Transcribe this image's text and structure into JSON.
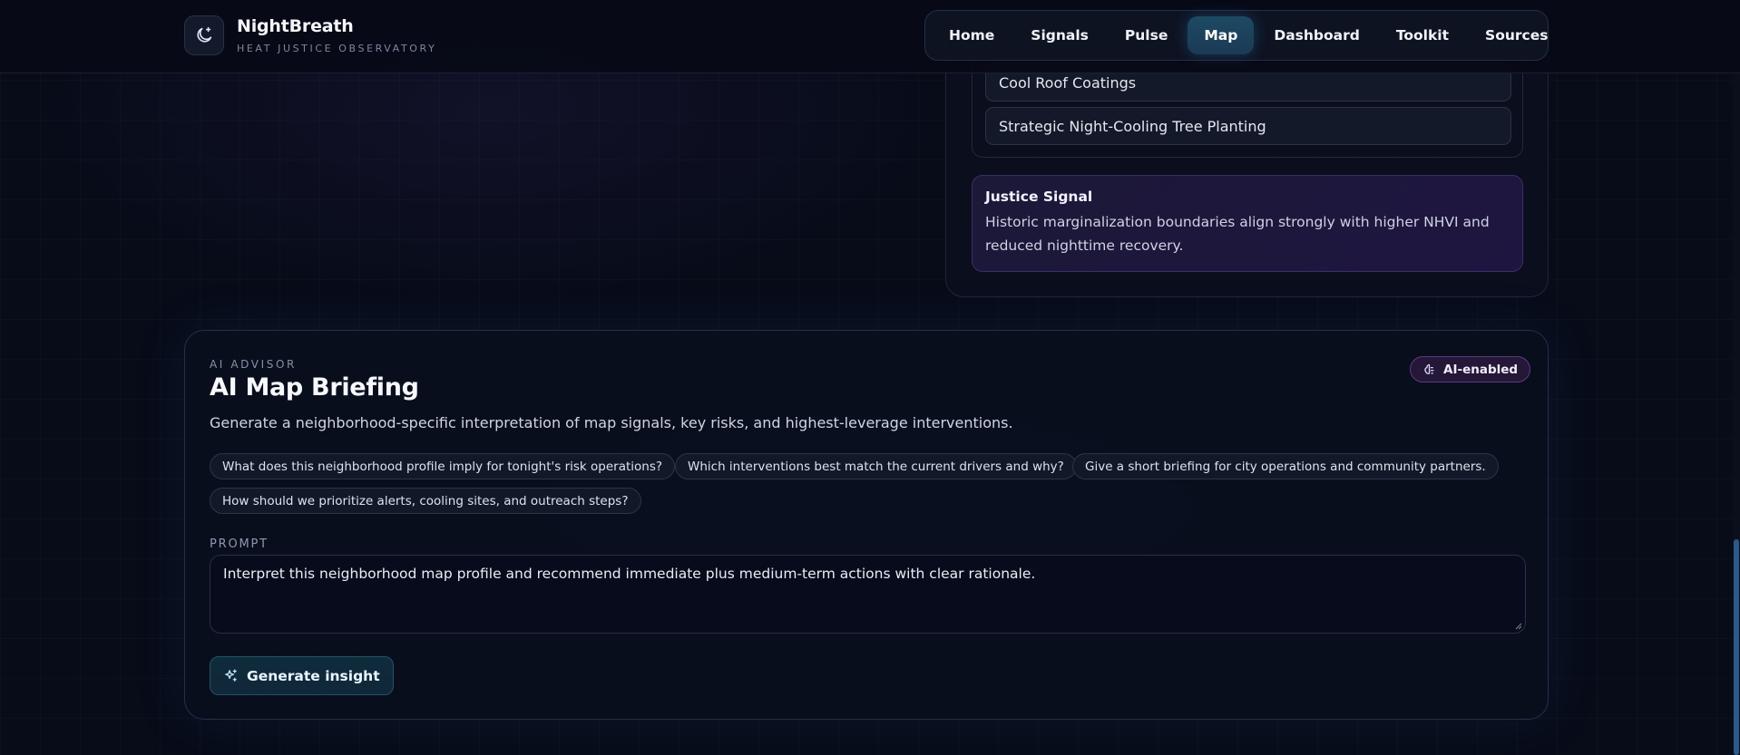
{
  "brand": {
    "name": "NightBreath",
    "tagline": "HEAT JUSTICE OBSERVATORY"
  },
  "nav": {
    "items": [
      {
        "label": "Home"
      },
      {
        "label": "Signals"
      },
      {
        "label": "Pulse"
      },
      {
        "label": "Map",
        "active": true
      },
      {
        "label": "Dashboard"
      },
      {
        "label": "Toolkit"
      },
      {
        "label": "Sources"
      }
    ]
  },
  "interventions": {
    "items": [
      "Cool Roof Coatings",
      "Strategic Night-Cooling Tree Planting"
    ]
  },
  "justice_signal": {
    "title": "Justice Signal",
    "body": "Historic marginalization boundaries align strongly with higher NHVI and reduced nighttime recovery."
  },
  "ai_panel": {
    "eyebrow": "AI ADVISOR",
    "title": "AI Map Briefing",
    "badge": "AI-enabled",
    "description": "Generate a neighborhood-specific interpretation of map signals, key risks, and highest-leverage interventions.",
    "suggestions": [
      "What does this neighborhood profile imply for tonight's risk operations?",
      "Which interventions best match the current drivers and why?",
      "Give a short briefing for city operations and community partners.",
      "How should we prioritize alerts, cooling sites, and outreach steps?"
    ],
    "prompt_label": "PROMPT",
    "prompt_value": "Interpret this neighborhood map profile and recommend immediate plus medium-term actions with clear rationale.",
    "generate_label": "Generate insight"
  },
  "colors": {
    "background": "#080c19",
    "accent_teal": "#1d4a63",
    "accent_purple": "#251737"
  }
}
